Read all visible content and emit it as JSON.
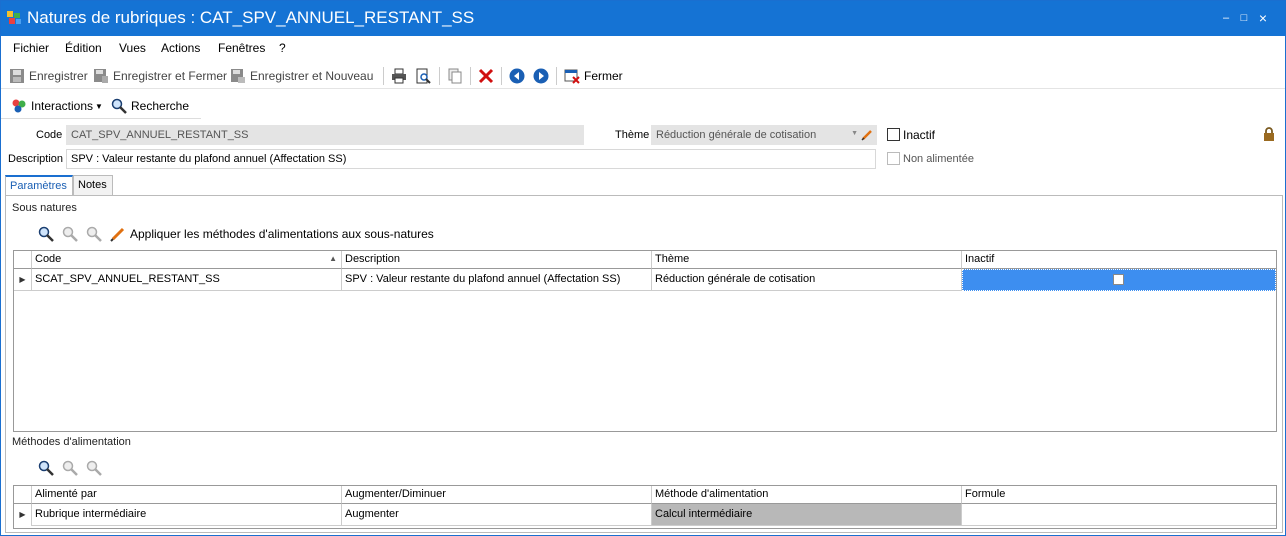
{
  "window": {
    "title": "Natures de rubriques : CAT_SPV_ANNUEL_RESTANT_SS",
    "minimize": "–",
    "maximize": "□",
    "close": "×"
  },
  "menu": {
    "items": [
      "Fichier",
      "Édition",
      "Vues",
      "Actions",
      "Fenêtres",
      "?"
    ]
  },
  "toolbar": {
    "save": "Enregistrer",
    "save_close": "Enregistrer et Fermer",
    "save_new": "Enregistrer et Nouveau",
    "close": "Fermer"
  },
  "toolbar2": {
    "interactions": "Interactions",
    "search": "Recherche"
  },
  "form": {
    "code_label": "Code",
    "code_value": "CAT_SPV_ANNUEL_RESTANT_SS",
    "theme_label": "Thème",
    "theme_value": "Réduction générale de cotisation",
    "inactif_label": "Inactif",
    "description_label": "Description",
    "description_value": "SPV : Valeur restante du plafond annuel (Affectation SS)",
    "non_alimentee_label": "Non alimentée"
  },
  "tabs": [
    "Paramètres",
    "Notes"
  ],
  "sous_natures": {
    "title": "Sous natures",
    "apply_label": "Appliquer les méthodes d'alimentations aux sous-natures",
    "columns": [
      "Code",
      "Description",
      "Thème",
      "Inactif"
    ],
    "rows": [
      {
        "code": "SCAT_SPV_ANNUEL_RESTANT_SS",
        "description": "SPV : Valeur restante du plafond annuel (Affectation SS)",
        "theme": "Réduction générale de cotisation",
        "inactif": false
      }
    ]
  },
  "methodes": {
    "title": "Méthodes d'alimentation",
    "columns": [
      "Alimenté par",
      "Augmenter/Diminuer",
      "Méthode d'alimentation",
      "Formule"
    ],
    "rows": [
      {
        "alimente_par": "Rubrique intermédiaire",
        "augmenter": "Augmenter",
        "methode": "Calcul intermédiaire",
        "formule": ""
      }
    ]
  },
  "colors": {
    "titlebar": "#1573d4",
    "selected_cell": "#3d8ef0",
    "method_cell": "#b8b8b8",
    "delete": "#d01010",
    "nav": "#1a5fb4"
  }
}
